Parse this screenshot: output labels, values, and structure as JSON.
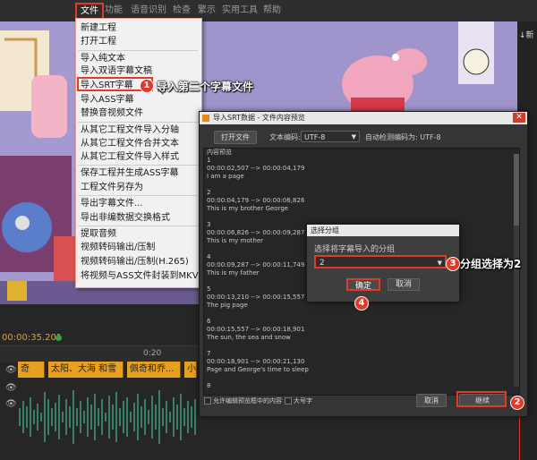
{
  "menubar": {
    "items": [
      "文件",
      "功能",
      "语音识别",
      "检查",
      "繁示",
      "实用工具",
      "帮助"
    ]
  },
  "file_menu": {
    "items": [
      "新建工程",
      "打开工程",
      "导入纯文本",
      "导入双语字幕文稿",
      "导入SRT字幕",
      "导入ASS字幕",
      "替换音视频文件",
      "从其它工程文件导入分轴",
      "从其它工程文件合并文本",
      "从其它工程文件导入样式",
      "保存工程并生成ASS字幕",
      "工程文件另存为",
      "导出字幕文件...",
      "导出非编数据交换格式",
      "提取音频",
      "视频转码输出/压制",
      "视频转码输出/压制(H.265)",
      "将视频与ASS文件封装到MKV"
    ]
  },
  "annotations": {
    "step1": "导入第二个字幕文件",
    "step3": "分组选择为2",
    "badge1": "1",
    "badge2": "2",
    "badge3": "3",
    "badge4": "4"
  },
  "timeline": {
    "timecode": "00:00:35.201",
    "ruler_mark": "0:20",
    "clips": [
      "奇",
      "太阳、大海 和雪",
      "佩奇和乔...",
      "小"
    ]
  },
  "import_dialog": {
    "title": "导入SRT数据 - 文件内容预览",
    "open_button": "打开文件",
    "encoding_label": "文本编码:",
    "encoding_value": "UTF-8",
    "autodetect_label": "自动检测编码为: UTF-8",
    "preview_label": "内容预览",
    "entries": [
      {
        "n": "1",
        "time": "00:00:02,507 --> 00:00:04,179",
        "text": "I am a page"
      },
      {
        "n": "2",
        "time": "00:00:04,179 --> 00:00:06,826",
        "text": "This is my brother George"
      },
      {
        "n": "3",
        "time": "00:00:06,826 --> 00:00:09,287",
        "text": "This is my mother"
      },
      {
        "n": "4",
        "time": "00:00:09,287 --> 00:00:11,749",
        "text": "This is my father"
      },
      {
        "n": "5",
        "time": "00:00:13,210 --> 00:00:15,557",
        "text": "The pig page"
      },
      {
        "n": "6",
        "time": "00:00:15,557 --> 00:00:18,901",
        "text": "The sun, the sea and snow"
      },
      {
        "n": "7",
        "time": "00:00:18,901 --> 00:00:21,130",
        "text": "Page and George's time to sleep"
      }
    ],
    "tail_number": "8",
    "checkbox1_label": "允许编辑预览框中的内容",
    "checkbox2_label": "大号字",
    "cancel_button": "取消",
    "continue_button": "继续"
  },
  "group_dialog": {
    "title": "选择分组",
    "prompt": "选择将字幕导入的分组",
    "selected_value": "2",
    "ok_button": "确定",
    "cancel_button": "取消"
  },
  "right_edge_label": "↓新",
  "colors": {
    "accent_red": "#e23a2a",
    "clip_orange": "#e8a020",
    "timecode": "#f0a010"
  }
}
